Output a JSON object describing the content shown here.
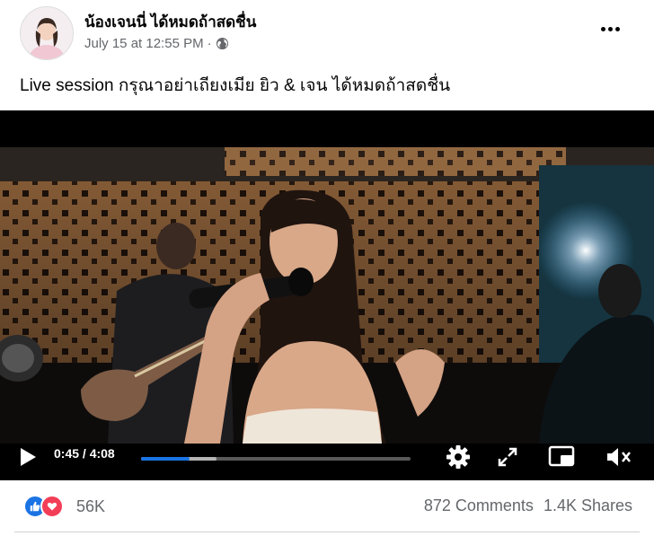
{
  "post": {
    "author": "น้องเจนนี่ ได้หมดถ้าสดชื่น",
    "timestamp": "July 15 at 12:55 PM",
    "separator": "·",
    "audience_icon": "globe-icon",
    "caption": "Live session กรุณาอย่าเถียงเมีย ยิว & เจน ได้หมดถ้าสดชื่น"
  },
  "video": {
    "current_time": "0:45",
    "duration": "4:08",
    "time_display": "0:45 / 4:08",
    "progress": 0.18,
    "buffered": 0.28,
    "icons": [
      "play-icon",
      "settings-gear-icon",
      "expand-icon",
      "picture-in-picture-icon",
      "volume-muted-icon"
    ]
  },
  "engagement": {
    "reaction_count": "56K",
    "reactions": [
      "like",
      "love"
    ],
    "comments": "872 Comments",
    "shares": "1.4K Shares"
  },
  "colors": {
    "like_blue": "#1b74e4",
    "love_red": "#f33e58",
    "secondary_text": "#65676b"
  }
}
